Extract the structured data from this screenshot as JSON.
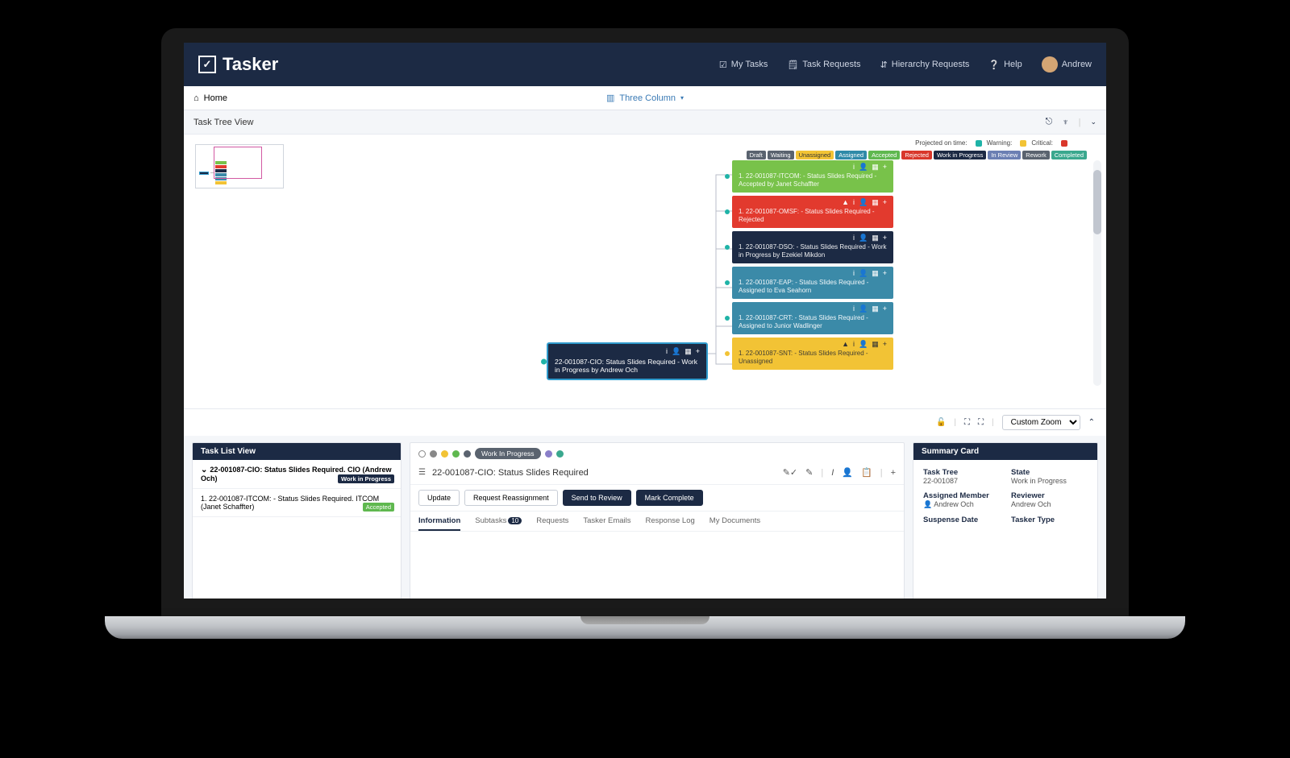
{
  "brand": "Tasker",
  "nav": {
    "my_tasks": "My Tasks",
    "task_requests": "Task Requests",
    "hierarchy_requests": "Hierarchy Requests",
    "help": "Help",
    "user_name": "Andrew"
  },
  "breadcrumb": {
    "home": "Home",
    "view_mode": "Three Column"
  },
  "tree_panel": {
    "title": "Task Tree View"
  },
  "legend": {
    "projected_label": "Projected on time:",
    "warning_label": "Warning:",
    "critical_label": "Critical:",
    "colors": {
      "ontime": "#1fb3a7",
      "warning": "#f2c335",
      "critical": "#d9372b"
    },
    "statuses": [
      {
        "label": "Draft",
        "bg": "#5a636f"
      },
      {
        "label": "Waiting",
        "bg": "#5a636f"
      },
      {
        "label": "Unassigned",
        "bg": "#f2c335",
        "fg": "#333"
      },
      {
        "label": "Assigned",
        "bg": "#2f8aa8"
      },
      {
        "label": "Accepted",
        "bg": "#5fb84f"
      },
      {
        "label": "Rejected",
        "bg": "#d9372b"
      },
      {
        "label": "Work in Progress",
        "bg": "#1c2a44"
      },
      {
        "label": "In Review",
        "bg": "#6b7fb3"
      },
      {
        "label": "Rework",
        "bg": "#5a636f"
      },
      {
        "label": "Completed",
        "bg": "#3aa88e"
      }
    ]
  },
  "root_node": {
    "text": "22-001087-CIO: Status Slides Required - Work in Progress by Andrew Och",
    "dot": "#1fb3a7"
  },
  "children": [
    {
      "text": "1. 22-001087-ITCOM:  - Status Slides Required - Accepted by Janet Schaffter",
      "bg": "#78c24a",
      "dot": "#1fb3a7",
      "warn": false
    },
    {
      "text": "1. 22-001087-OMSF:  - Status Slides Required - Rejected",
      "bg": "#e23a2e",
      "dot": "#1fb3a7",
      "warn": true
    },
    {
      "text": "1. 22-001087-DSO:  - Status Slides Required - Work in Progress by Ezekiel Mikdon",
      "bg": "#1c2a44",
      "dot": "#1fb3a7",
      "warn": false
    },
    {
      "text": "1. 22-001087-EAP:  - Status Slides Required - Assigned to Eva Seahorn",
      "bg": "#3b8aa8",
      "dot": "#1fb3a7",
      "warn": false
    },
    {
      "text": "1. 22-001087-CRT:  - Status Slides Required - Assigned to Junior Wadlinger",
      "bg": "#3b8aa8",
      "dot": "#1fb3a7",
      "warn": false
    },
    {
      "text": "1. 22-001087-SNT:  - Status Slides Required - Unassigned",
      "bg": "#f2c335",
      "fg": "#333",
      "dot": "#f2c335",
      "warn": true
    }
  ],
  "toolbar": {
    "zoom": "Custom Zoom"
  },
  "task_list": {
    "title": "Task List View",
    "items": [
      {
        "label": "22-001087-CIO: Status Slides Required. CIO (Andrew Och)",
        "badge": "Work in Progress",
        "badge_bg": "#1c2a44",
        "expanded": true
      },
      {
        "label": "1. 22-001087-ITCOM: - Status Slides Required. ITCOM (Janet Schaffter)",
        "badge": "Accepted",
        "badge_bg": "#5fb84f"
      }
    ]
  },
  "detail": {
    "status_pill": "Work In Progress",
    "title": "22-001087-CIO: Status Slides Required",
    "actions": {
      "update": "Update",
      "request_reassign": "Request Reassignment",
      "send_review": "Send to Review",
      "mark_complete": "Mark Complete"
    },
    "tabs": [
      {
        "label": "Information",
        "active": true
      },
      {
        "label": "Subtasks",
        "count": "10"
      },
      {
        "label": "Requests"
      },
      {
        "label": "Tasker Emails"
      },
      {
        "label": "Response Log"
      },
      {
        "label": "My Documents"
      }
    ],
    "status_dots": [
      {
        "color": "#ffffff",
        "border": "#888"
      },
      {
        "color": "#888888"
      },
      {
        "color": "#f2c335"
      },
      {
        "color": "#5fb84f"
      },
      {
        "color": "#5a636f"
      },
      {
        "pill": true
      },
      {
        "color": "#8a7fc9"
      },
      {
        "color": "#3aa88e"
      }
    ]
  },
  "summary": {
    "title": "Summary Card",
    "fields": {
      "task_tree_k": "Task Tree",
      "task_tree_v": "22-001087",
      "state_k": "State",
      "state_v": "Work in Progress",
      "assigned_k": "Assigned Member",
      "assigned_v": "Andrew Och",
      "reviewer_k": "Reviewer",
      "reviewer_v": "Andrew Och",
      "suspense_k": "Suspense Date",
      "suspense_v": "",
      "type_k": "Tasker Type",
      "type_v": ""
    }
  }
}
